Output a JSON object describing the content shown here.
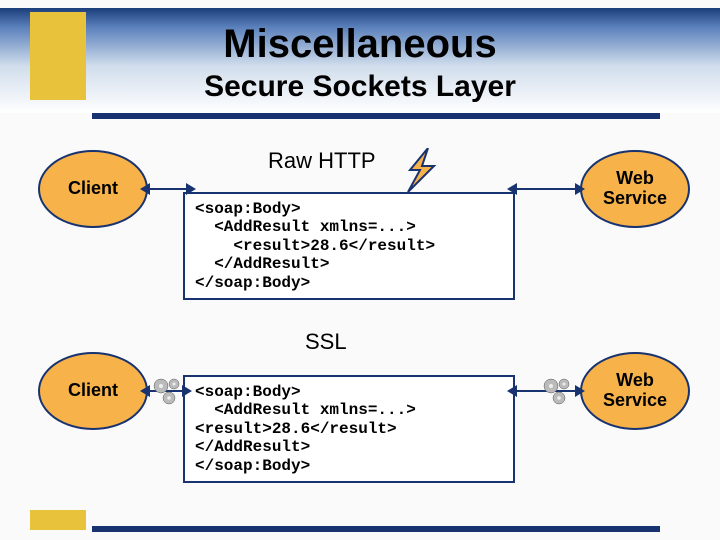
{
  "header": {
    "title": "Miscellaneous",
    "subtitle": "Secure Sockets Layer"
  },
  "nodes": {
    "client1": "Client",
    "client2": "Client",
    "ws1_line1": "Web",
    "ws1_line2": "Service",
    "ws2_line1": "Web",
    "ws2_line2": "Service"
  },
  "labels": {
    "raw_http": "Raw HTTP",
    "ssl": "SSL"
  },
  "code": {
    "top": "<soap:Body>\n  <AddResult xmlns=...>\n    <result>28.6</result>\n  </AddResult>\n</soap:Body>",
    "bottom": "<soap:Body>\n  <AddResult xmlns=...>\n<result>28.6</result>\n</AddResult>\n</soap:Body>"
  },
  "icons": {
    "bolt": "lightning-icon",
    "gears": "gears-icon"
  }
}
